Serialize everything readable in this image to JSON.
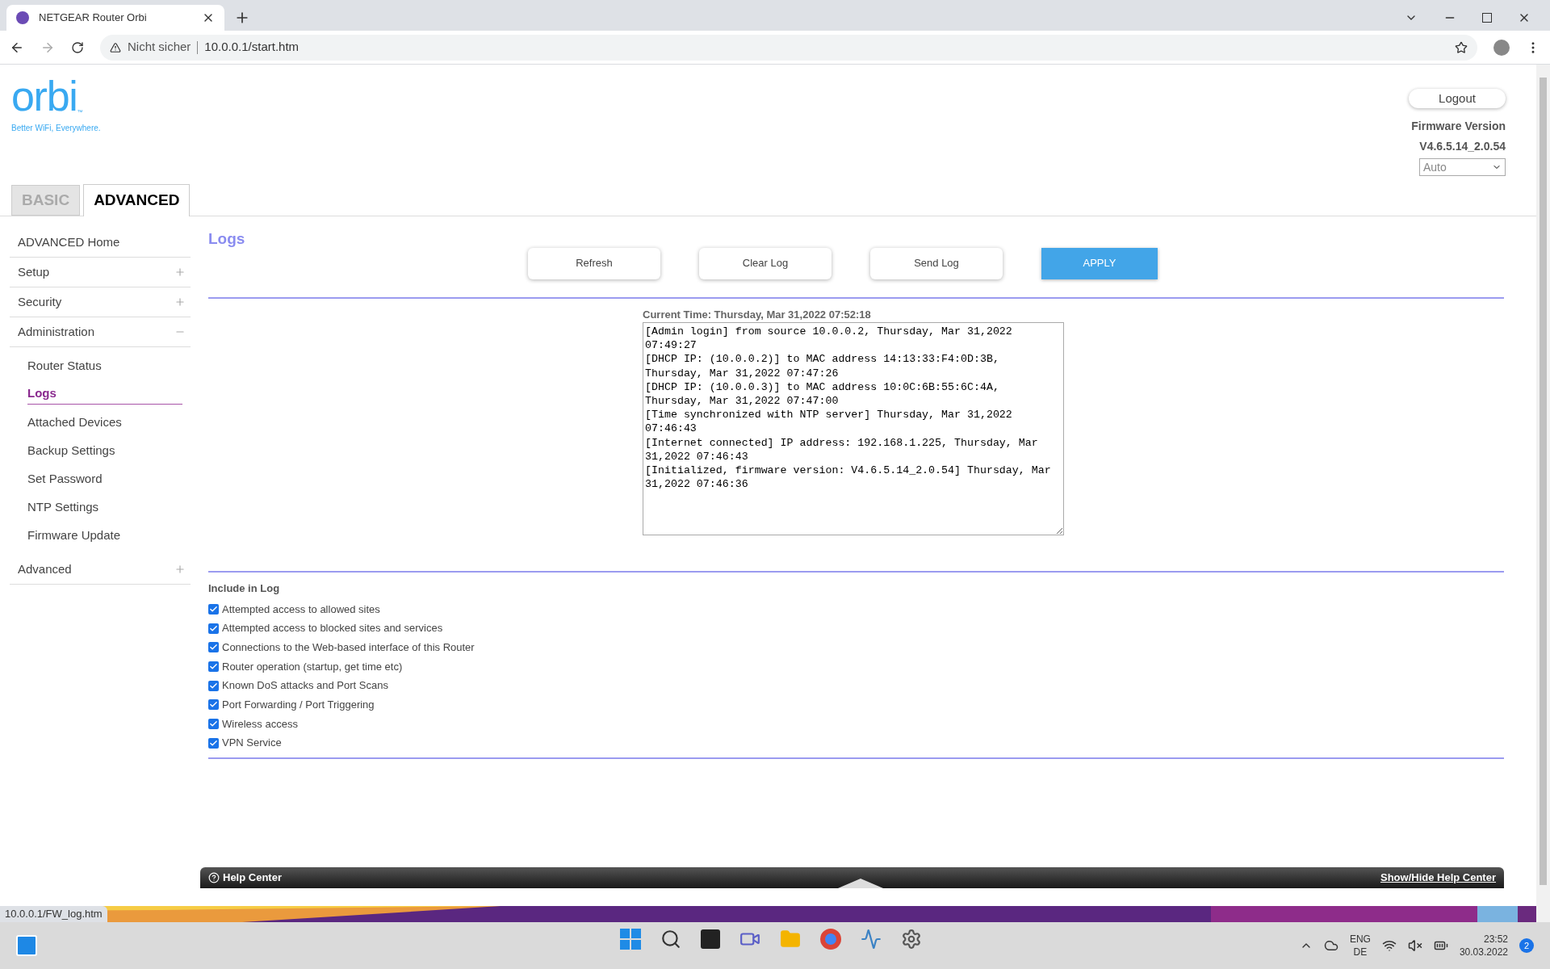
{
  "browser": {
    "tab_title": "NETGEAR Router Orbi",
    "security": "Nicht sicher",
    "url": "10.0.0.1/start.htm",
    "status_url": "10.0.0.1/FW_log.htm"
  },
  "header": {
    "logo": "orbi",
    "trademark": "™",
    "tagline": "Better WiFi, Everywhere.",
    "logout": "Logout",
    "firmware_label": "Firmware Version",
    "firmware_version": "V4.6.5.14_2.0.54",
    "language": "Auto"
  },
  "tabs": [
    {
      "label": "BASIC",
      "selected": false
    },
    {
      "label": "ADVANCED",
      "selected": true
    }
  ],
  "sidebar": {
    "items": [
      {
        "label": "ADVANCED Home",
        "kind": "link"
      },
      {
        "label": "Setup",
        "kind": "group",
        "expanded": false
      },
      {
        "label": "Security",
        "kind": "group",
        "expanded": false
      },
      {
        "label": "Administration",
        "kind": "group",
        "expanded": true,
        "children": [
          {
            "label": "Router Status",
            "selected": false
          },
          {
            "label": "Logs",
            "selected": true
          },
          {
            "label": "Attached Devices",
            "selected": false
          },
          {
            "label": "Backup Settings",
            "selected": false
          },
          {
            "label": "Set Password",
            "selected": false
          },
          {
            "label": "NTP Settings",
            "selected": false
          },
          {
            "label": "Firmware Update",
            "selected": false
          }
        ]
      },
      {
        "label": "Advanced",
        "kind": "group",
        "expanded": false
      }
    ]
  },
  "page_title": "Logs",
  "buttons": [
    {
      "label": "Refresh",
      "primary": false
    },
    {
      "label": "Clear Log",
      "primary": false
    },
    {
      "label": "Send Log",
      "primary": false
    },
    {
      "label": "APPLY",
      "primary": true
    }
  ],
  "current_time": "Current Time: Thursday, Mar 31,2022 07:52:18",
  "log_entries": [
    "[Admin login] from source 10.0.0.2, Thursday, Mar 31,2022 07:49:27",
    "[DHCP IP: (10.0.0.2)] to MAC address 14:13:33:F4:0D:3B, Thursday, Mar 31,2022 07:47:26",
    "[DHCP IP: (10.0.0.3)] to MAC address 10:0C:6B:55:6C:4A, Thursday, Mar 31,2022 07:47:00",
    "[Time synchronized with NTP server] Thursday, Mar 31,2022 07:46:43",
    "[Internet connected] IP address: 192.168.1.225, Thursday, Mar 31,2022 07:46:43",
    "[Initialized, firmware version: V4.6.5.14_2.0.54] Thursday, Mar 31,2022 07:46:36"
  ],
  "include_label": "Include in Log",
  "options": [
    {
      "label": "Attempted access to allowed sites",
      "checked": true
    },
    {
      "label": "Attempted access to blocked sites and services",
      "checked": true
    },
    {
      "label": "Connections to the Web-based interface of this Router",
      "checked": true
    },
    {
      "label": "Router operation (startup, get time etc)",
      "checked": true
    },
    {
      "label": "Known DoS attacks and Port Scans",
      "checked": true
    },
    {
      "label": "Port Forwarding / Port Triggering",
      "checked": true
    },
    {
      "label": "Wireless access",
      "checked": true
    },
    {
      "label": "VPN Service",
      "checked": true
    }
  ],
  "help_center": {
    "label": "Help Center",
    "toggle": "Show/Hide Help Center"
  },
  "taskbar": {
    "language": "ENG",
    "region": "DE",
    "time": "23:52",
    "date": "30.03.2022",
    "notifications": "2"
  }
}
